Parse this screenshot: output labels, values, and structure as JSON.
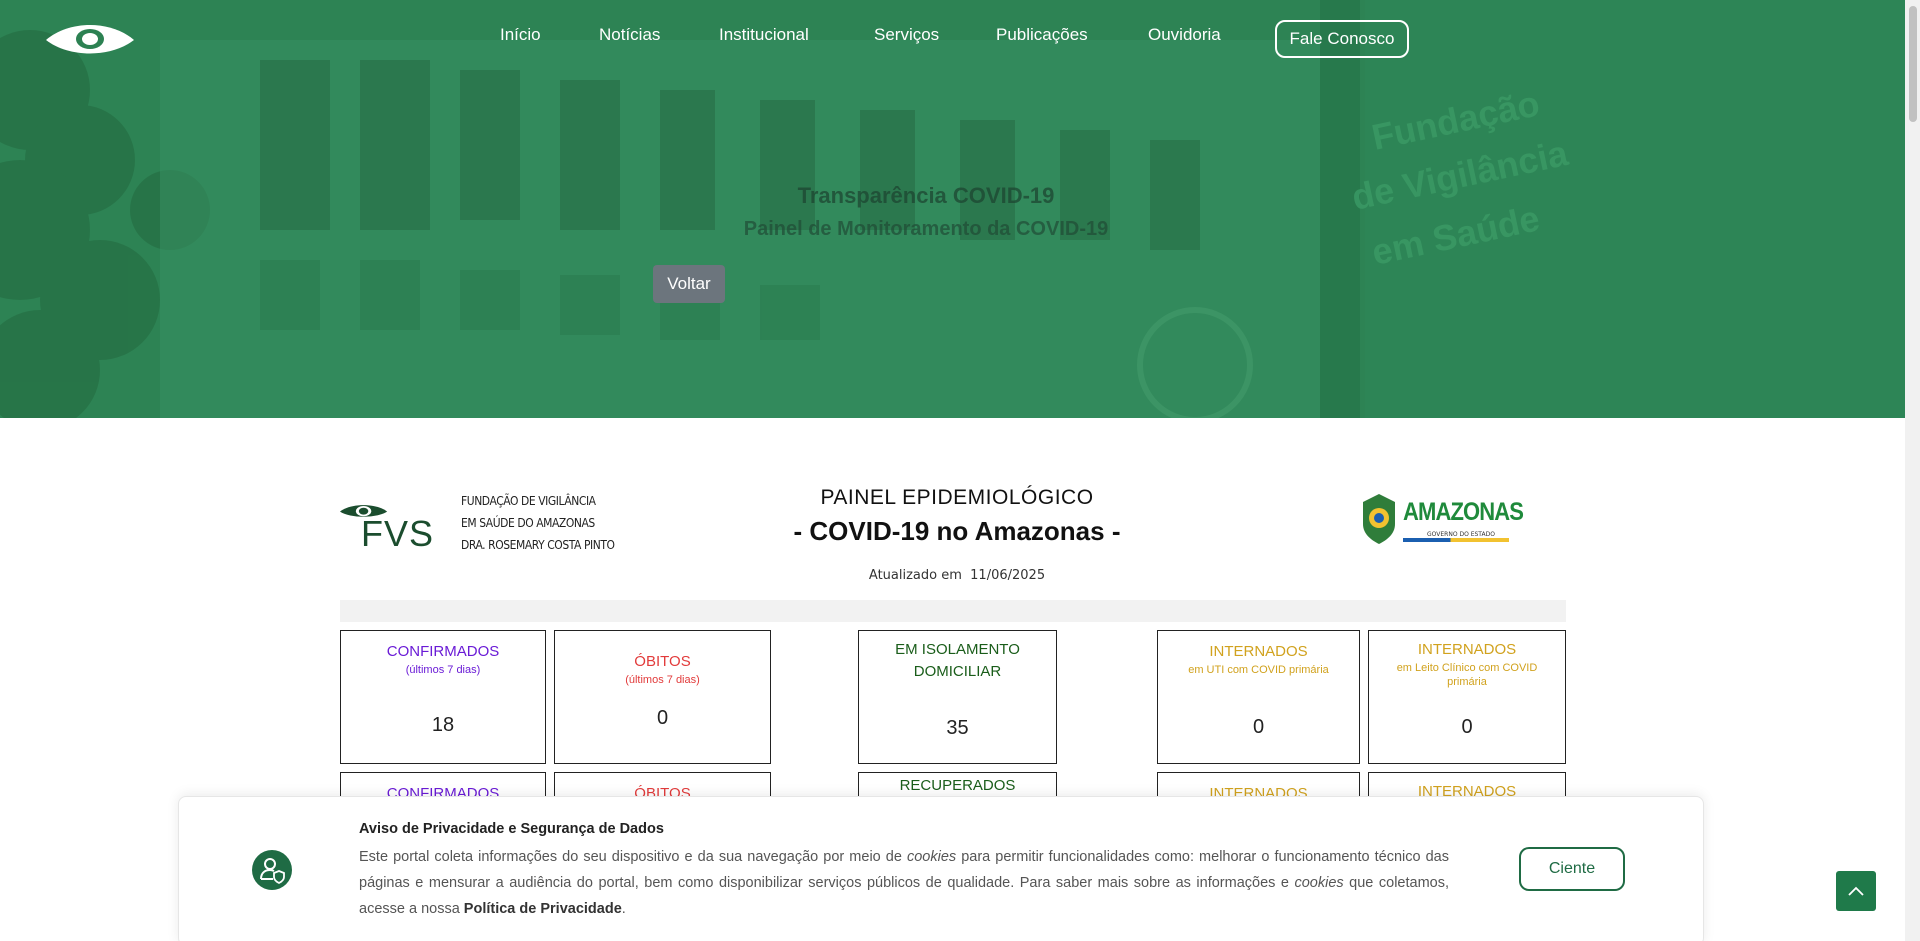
{
  "nav": {
    "items": [
      "Início",
      "Notícias",
      "Institucional",
      "Serviços",
      "Publicações",
      "Ouvidoria"
    ],
    "cta": "Fale Conosco"
  },
  "hero": {
    "title": "Transparência COVID-19",
    "subtitle": "Painel de Monitoramento da COVID-19",
    "back": "Voltar"
  },
  "dashboard": {
    "fvs_lines": [
      "FUNDAÇÃO DE VIGILÂNCIA",
      "EM SAÚDE DO AMAZONAS",
      "DRA. ROSEMARY COSTA PINTO"
    ],
    "fvs_abbr": "FVS",
    "panel_title": "PAINEL EPIDEMIOLÓGICO",
    "panel_subtitle": "- COVID-19 no Amazonas -",
    "updated_label": "Atualizado em",
    "updated_date": "11/06/2025",
    "am_logo_text": "AMAZONAS",
    "am_logo_sub": "GOVERNO DO ESTADO",
    "cards": [
      {
        "title": "CONFIRMADOS",
        "sub": "(últimos 7 dias)",
        "value": "18",
        "color": "#6a1bd6"
      },
      {
        "title": "ÓBITOS",
        "sub": "(últimos 7 dias)",
        "value": "0",
        "color": "#e23b3b"
      },
      {
        "title": "EM ISOLAMENTO DOMICILIAR",
        "sub": "",
        "value": "35",
        "color": "#1a5d1a"
      },
      {
        "title": "INTERNADOS",
        "sub": "em UTI com COVID primária",
        "value": "0",
        "color": "#d1a21e"
      },
      {
        "title": "INTERNADOS",
        "sub": "em Leito Clínico com COVID primária",
        "value": "0",
        "color": "#d1a21e"
      }
    ],
    "row2": [
      "CONFIRMADOS",
      "ÓBITOS",
      "RECUPERADOS",
      "INTERNADOS",
      "INTERNADOS"
    ]
  },
  "privacy": {
    "title": "Aviso de Privacidade e Segurança de Dados",
    "p1": "Este portal coleta informações do seu dispositivo e da sua navegação por meio de ",
    "cookies": "cookies",
    "p2": " para permitir funcionalidades como: melhorar o funcionamento técnico das páginas e mensurar a audiência do portal, bem como disponibilizar serviços públicos de qualidade. Para saber mais sobre as informações e ",
    "p3": " que coletamos, acesse a nossa ",
    "link": "Política de Privacidade",
    "end": ".",
    "button": "Ciente"
  },
  "icons": {
    "logo": "eye-logo-icon",
    "privacy": "user-shield-icon",
    "back_to_top": "chevron-up-icon"
  },
  "colors": {
    "hero_green": "#2a7c4f",
    "brand_green": "#1f6b44",
    "confirmados": "#6a1bd6",
    "obitos": "#e23b3b",
    "isolamento": "#1a5d1a",
    "internados": "#d1a21e"
  }
}
